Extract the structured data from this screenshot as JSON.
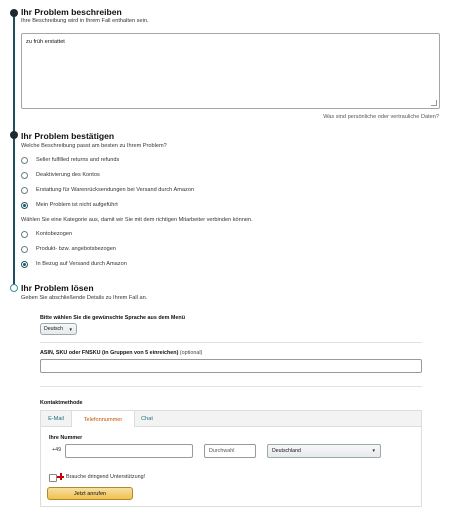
{
  "step1": {
    "title": "Ihr Problem beschreiben",
    "subtitle": "Ihre Beschreibung wird in Ihrem Fall enthalten sein.",
    "textarea_value": "zu früh erstattet",
    "privacy_link": "Was sind persönliche oder vertrauliche Daten?"
  },
  "step2": {
    "title": "Ihr Problem bestätigen",
    "question1": "Welche Beschreibung passt am besten zu Ihrem Problem?",
    "options1": [
      {
        "label": "Seller fulfilled returns and refunds",
        "selected": false
      },
      {
        "label": "Deaktivierung des Kontos",
        "selected": false
      },
      {
        "label": "Erstattung für Warenrücksendungen bei Versand durch Amazon",
        "selected": false
      },
      {
        "label": "Mein Problem ist nicht aufgeführt",
        "selected": true
      }
    ],
    "question2": "Wählen Sie eine Kategorie aus, damit wir Sie mit dem richtigen Mitarbeiter verbinden können.",
    "options2": [
      {
        "label": "Kontobezogen",
        "selected": false
      },
      {
        "label": "Produkt- bzw. angebotsbezogen",
        "selected": false
      },
      {
        "label": "In Bezug auf Versand durch Amazon",
        "selected": true
      }
    ]
  },
  "step3": {
    "title": "Ihr Problem lösen",
    "subtitle": "Geben Sie abschließende Details zu Ihrem Fall an.",
    "language_label": "Bitte wählen Sie die gewünschte Sprache aus dem Menü",
    "language_value": "Deutsch",
    "asin_label": "ASIN, SKU oder FNSKU (in Gruppen von 5 einreichen)",
    "asin_optional": "(optional)",
    "asin_value": "",
    "contact_method_label": "Kontaktmethode",
    "tabs": [
      {
        "label": "E-Mail",
        "active": false
      },
      {
        "label": "Telefonnummer",
        "active": true
      },
      {
        "label": "Chat",
        "active": false
      }
    ],
    "phone_label": "Ihre Nummer",
    "phone_prefix": "+49",
    "phone_value": "",
    "extension_placeholder": "Durchwahl",
    "country_value": "Deutschland",
    "urgent_label": "Brauche dringend Unterstützung!",
    "call_button": "Jetzt anrufen"
  },
  "colors": {
    "timeline": "#1f4f5e",
    "radio_selected": "#1f5a6b",
    "active_tab": "#c45500",
    "button": "#f0c14b",
    "urgent_icon": "#c40000"
  }
}
